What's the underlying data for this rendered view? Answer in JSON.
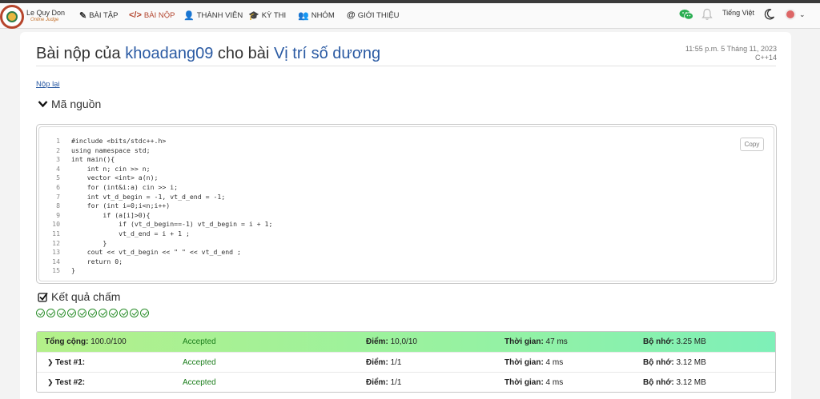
{
  "brand": {
    "title": "Le Quy Don",
    "subtitle": "Online Judge"
  },
  "nav": [
    {
      "icon": "✎",
      "label": "BÀI TẬP"
    },
    {
      "icon": "</>",
      "label": "BÀI NỘP"
    },
    {
      "icon": "👤",
      "label": "THÀNH VIÊN"
    },
    {
      "icon": "🎓",
      "label": "KỲ THI"
    },
    {
      "icon": "👥",
      "label": "NHÓM"
    },
    {
      "icon": "@",
      "label": "GIỚI THIỆU"
    }
  ],
  "language_switch": "Tiếng Việt",
  "submission": {
    "title_prefix": "Bài nộp của",
    "user": "khoadang09",
    "title_mid": "cho bài",
    "problem": "Vị trí số dương",
    "time": "11:55 p.m. 5 Tháng 11, 2023",
    "language": "C++14",
    "resubmit": "Nộp lại"
  },
  "source_section": {
    "title": "Mã nguồn",
    "copy": "Copy"
  },
  "code_lines": [
    "#include <bits/stdc++.h>",
    "using namespace std;",
    "int main(){",
    "    int n; cin >> n;",
    "    vector <int> a(n);",
    "    for (int&i:a) cin >> i;",
    "    int vt_d_begin = -1, vt_d_end = -1;",
    "    for (int i=0;i<n;i++)",
    "        if (a[i]>0){",
    "            if (vt_d_begin==-1) vt_d_begin = i + 1;",
    "            vt_d_end = i + 1 ;",
    "        }",
    "    cout << vt_d_begin << \" \" << vt_d_end ;",
    "    return 0;",
    "}"
  ],
  "results_section": {
    "title": "Kết quả chấm",
    "passed_count": 11
  },
  "results": [
    {
      "label": "Tổng cộng:",
      "label_value": "100.0/100",
      "status": "Accepted",
      "score_label": "Điểm:",
      "score": "10,0/10",
      "time_label": "Thời gian:",
      "time": "47 ms",
      "mem_label": "Bộ nhớ:",
      "memory": "3.25 MB"
    },
    {
      "label": "Test #1:",
      "label_value": "",
      "status": "Accepted",
      "score_label": "Điểm:",
      "score": "1/1",
      "time_label": "Thời gian:",
      "time": "4 ms",
      "mem_label": "Bộ nhớ:",
      "memory": "3.12 MB"
    },
    {
      "label": "Test #2:",
      "label_value": "",
      "status": "Accepted",
      "score_label": "Điểm:",
      "score": "1/1",
      "time_label": "Thời gian:",
      "time": "4 ms",
      "mem_label": "Bộ nhớ:",
      "memory": "3.12 MB"
    }
  ]
}
